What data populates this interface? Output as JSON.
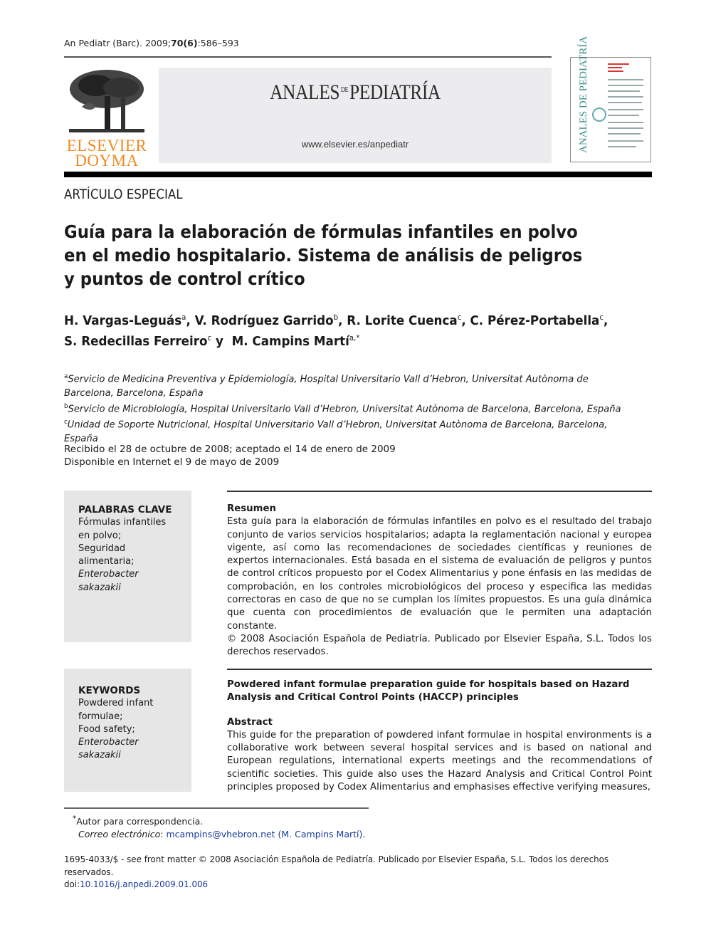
{
  "header": {
    "citation_prefix": "An Pediatr (Barc). 2009;",
    "citation_bold": "70(6)",
    "citation_pages": ":586–593",
    "publisher_logo_line1": "ELSEVIER",
    "publisher_logo_line2": "DOYMA",
    "journal_name_part1": "ANALES",
    "journal_name_small": "DE",
    "journal_name_part2": "PEDIATRÍA",
    "journal_url": "www.elsevier.es/anpediatr",
    "cover_spine_text": "ANALES DE PEDIATRÍA",
    "colors": {
      "logo_orange": "#f08a24",
      "cover_teal": "#3a8c8a",
      "masthead_bg": "#ececee",
      "link_blue": "#1a3aa0"
    }
  },
  "article": {
    "section": "ARTÍCULO ESPECIAL",
    "title": "Guía para la elaboración de fórmulas infantiles en polvo en el medio hospitalario. Sistema de análisis de peligros y puntos de control crítico",
    "authors": [
      {
        "name": "H. Vargas-Leguás",
        "sup": "a",
        "sep": ", "
      },
      {
        "name": "V. Rodríguez Garrido",
        "sup": "b",
        "sep": ", "
      },
      {
        "name": "R. Lorite Cuenca",
        "sup": "c",
        "sep": ", "
      },
      {
        "name": "C. Pérez-Portabella",
        "sup": "c",
        "sep": ","
      },
      {
        "name": "S. Redecillas Ferreiro",
        "sup": "c",
        "sep": " y "
      },
      {
        "name": "M. Campins Martí",
        "sup": "a,*",
        "sep": ""
      }
    ],
    "affiliations": [
      {
        "mark": "a",
        "text": "Servicio de Medicina Preventiva y Epidemiología, Hospital Universitario Vall d’Hebron, Universitat Autònoma de Barcelona, Barcelona, España"
      },
      {
        "mark": "b",
        "text": "Servicio de Microbiología, Hospital Universitario Vall d’Hebron, Universitat Autònoma de Barcelona, Barcelona, España"
      },
      {
        "mark": "c",
        "text": "Unidad de Soporte Nutricional, Hospital Universitario Vall d’Hebron, Universitat Autònoma de Barcelona, Barcelona, España"
      }
    ],
    "dates_line1": "Recibido el 28 de octubre de 2008; aceptado el 14 de enero de 2009",
    "dates_line2": "Disponible en Internet el 9 de mayo de 2009"
  },
  "keywords_es": {
    "heading": "PALABRAS CLAVE",
    "items": [
      "Fórmulas infantiles en polvo;",
      "Seguridad alimentaria;"
    ],
    "italic_item_line1": "Enterobacter",
    "italic_item_line2": "sakazakii"
  },
  "resumen": {
    "heading": "Resumen",
    "body": "Esta guía para la elaboración de fórmulas infantiles en polvo es el resultado del trabajo conjunto de varios servicios hospitalarios; adapta la reglamentación nacional y europea vigente, así como las recomendaciones de sociedades científicas y reuniones de expertos internacionales. Está basada en el sistema de evaluación de peligros y puntos de control críticos propuesto por el Codex Alimentarius y pone énfasis en las medidas de comprobación, en los controles microbiológicos del proceso y especifica las medidas correctoras en caso de que no se cumplan los límites propuestos. Es una guía dinámica que cuenta con procedimientos de evaluación que le permiten una adaptación constante.",
    "copyright": "© 2008 Asociación Española de Pediatría. Publicado por Elsevier España, S.L. Todos los derechos reservados."
  },
  "keywords_en": {
    "heading": "KEYWORDS",
    "items": [
      "Powdered infant formulae;",
      "Food safety;"
    ],
    "italic_item_line1": "Enterobacter",
    "italic_item_line2": "sakazakii"
  },
  "abstract": {
    "english_title": "Powdered infant formulae preparation guide for hospitals based on Hazard Analysis and Critical Control Points (HACCP) principles",
    "heading": "Abstract",
    "body": "This guide for the preparation of powdered infant formulae in hospital environments is a collaborative work between several hospital services and is based on national and European regulations, international experts meetings and the recommendations of scientific societies. This guide also uses the Hazard Analysis and Critical Control Point principles proposed by Codex Alimentarius and emphasises effective verifying measures,"
  },
  "footnote": {
    "mark": "*",
    "text": "Autor para correspondencia.",
    "email_label": "Correo electrónico",
    "email_sep": ": ",
    "email_link": "mcampins@vhebron.net (M. Campins Martí)",
    "email_end": "."
  },
  "bottom": {
    "front_matter": "1695-4033/$ - see front matter © 2008 Asociación Española de Pediatría. Publicado por Elsevier España, S.L. Todos los derechos reservados.",
    "doi_label": "doi:",
    "doi_link": "10.1016/j.anpedi.2009.01.006"
  }
}
